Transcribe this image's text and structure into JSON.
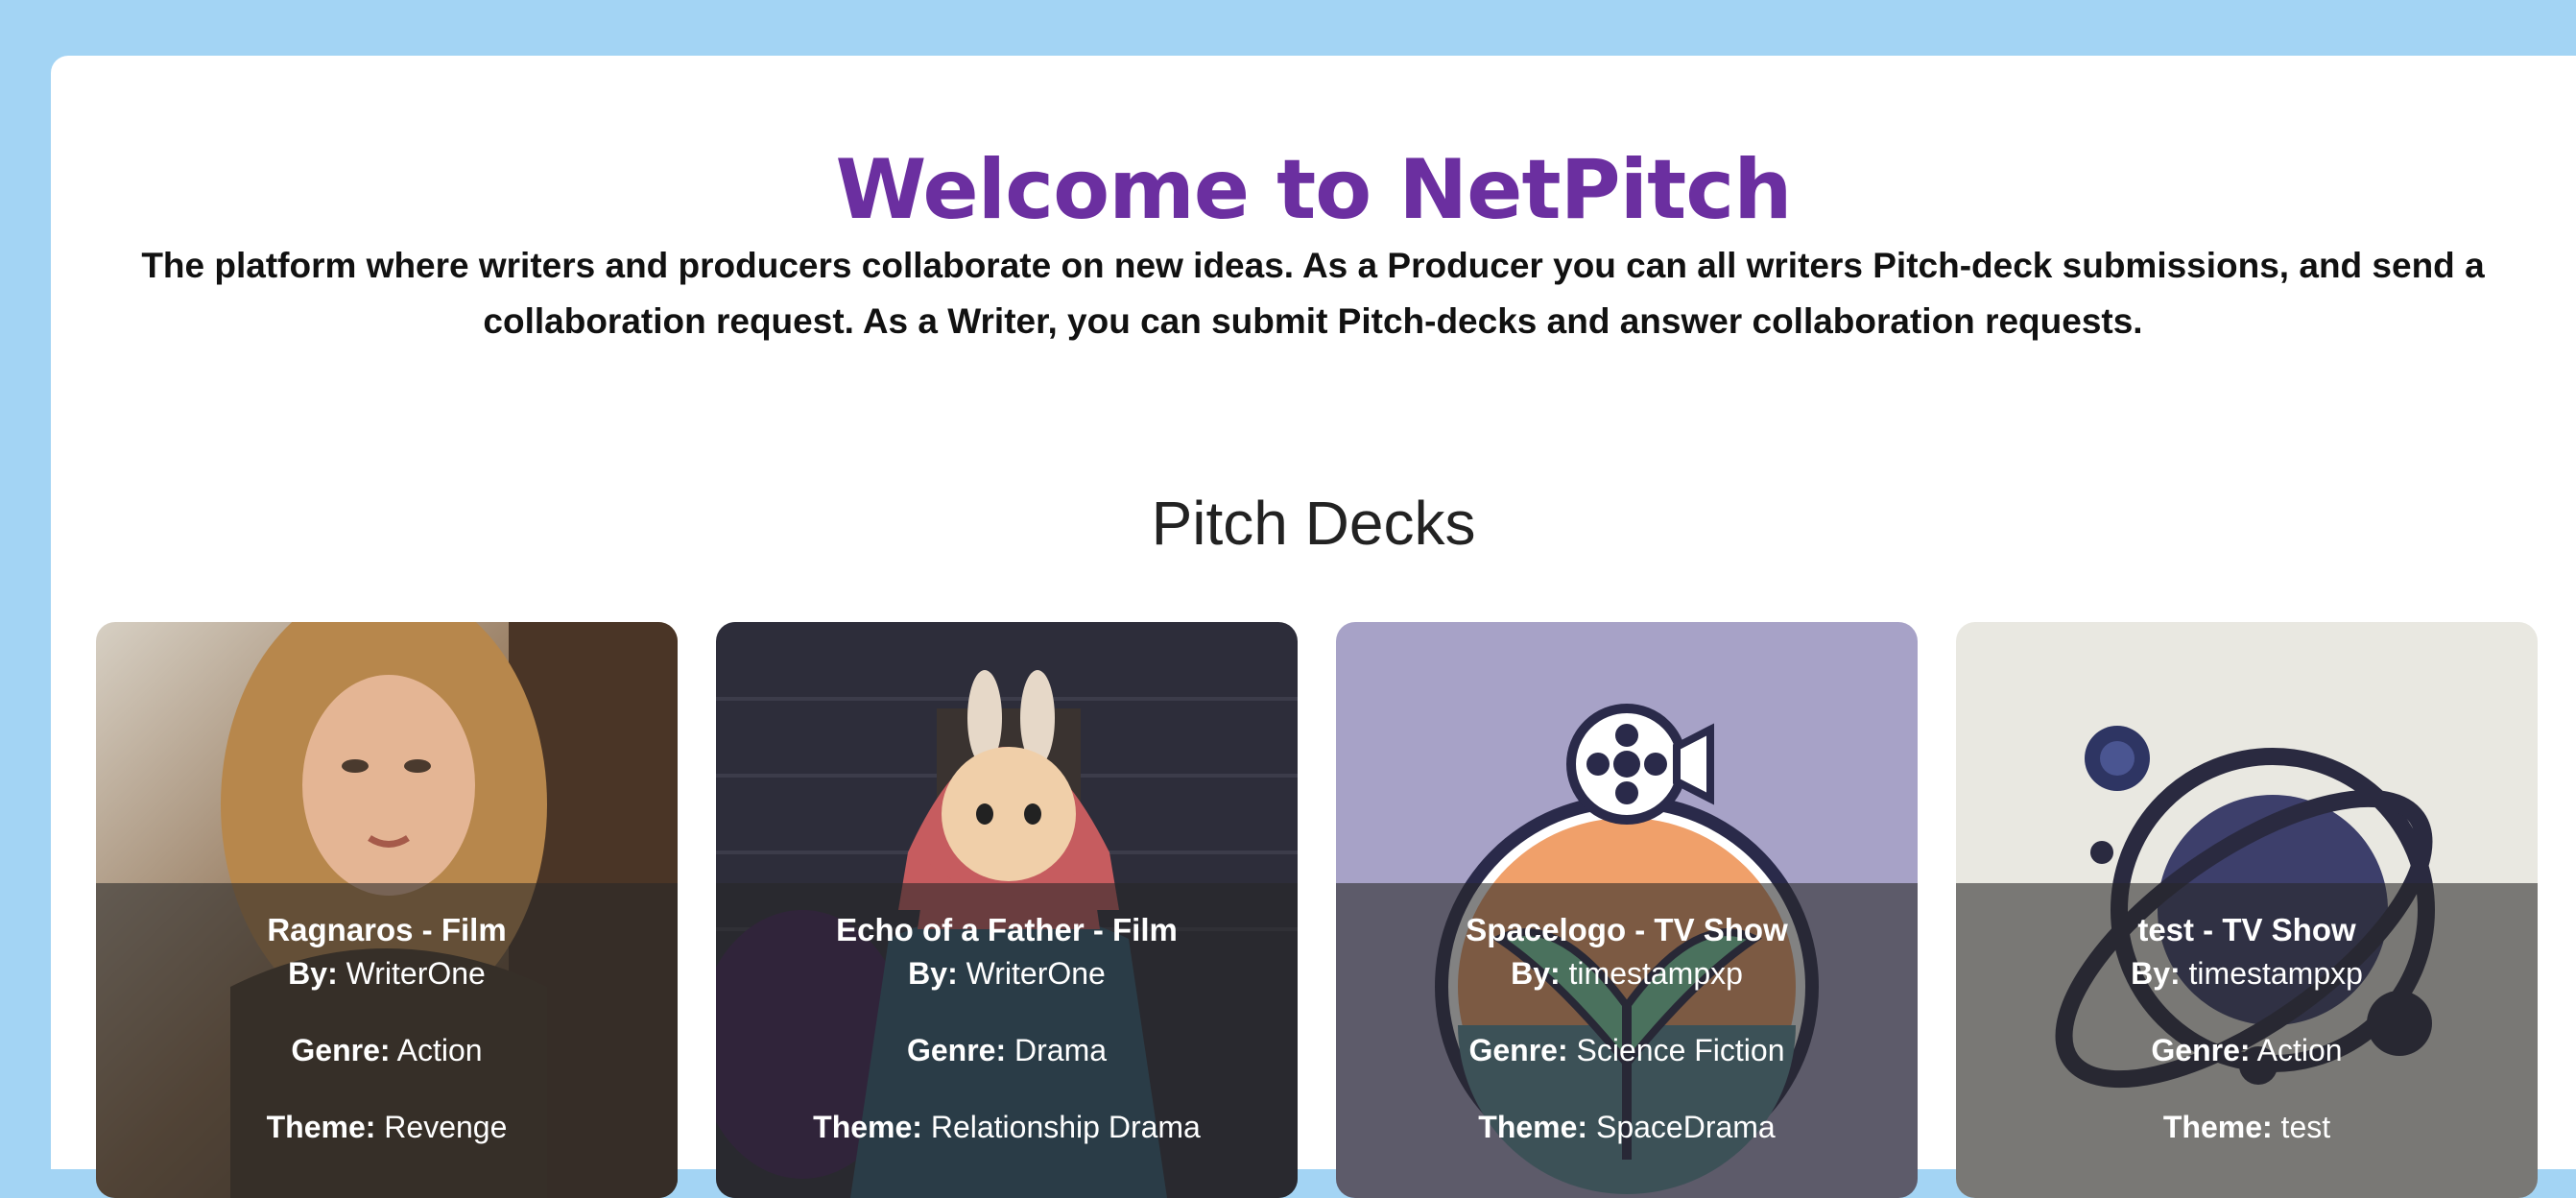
{
  "header": {
    "title": "Welcome to NetPitch",
    "intro": "The platform where writers and producers collaborate on new ideas. As a Producer you can all writers Pitch-deck submissions, and send a collaboration request. As a Writer, you can submit Pitch-decks and answer collaboration requests."
  },
  "section_title": "Pitch Decks",
  "labels": {
    "by": "By:",
    "genre": "Genre:",
    "theme": "Theme:"
  },
  "decks": [
    {
      "title": "Ragnaros - Film",
      "author": "WriterOne",
      "genre": "Action",
      "theme": "Revenge",
      "image_icon": "warrior-woman-portrait"
    },
    {
      "title": "Echo of a Father - Film",
      "author": "WriterOne",
      "genre": "Drama",
      "theme": "Relationship Drama",
      "image_icon": "hooded-boy-portrait"
    },
    {
      "title": "Spacelogo - TV Show",
      "author": "timestampxp",
      "genre": "Science Fiction",
      "theme": "SpaceDrama",
      "image_icon": "film-camera-plant-logo"
    },
    {
      "title": "test - TV Show",
      "author": "timestampxp",
      "genre": "Action",
      "theme": "test",
      "image_icon": "planet-orbit-logo"
    }
  ],
  "colors": {
    "page_bg": "#a3d4f4",
    "title": "#6b2fa0",
    "card_overlay": "rgba(40,40,40,0.58)"
  }
}
